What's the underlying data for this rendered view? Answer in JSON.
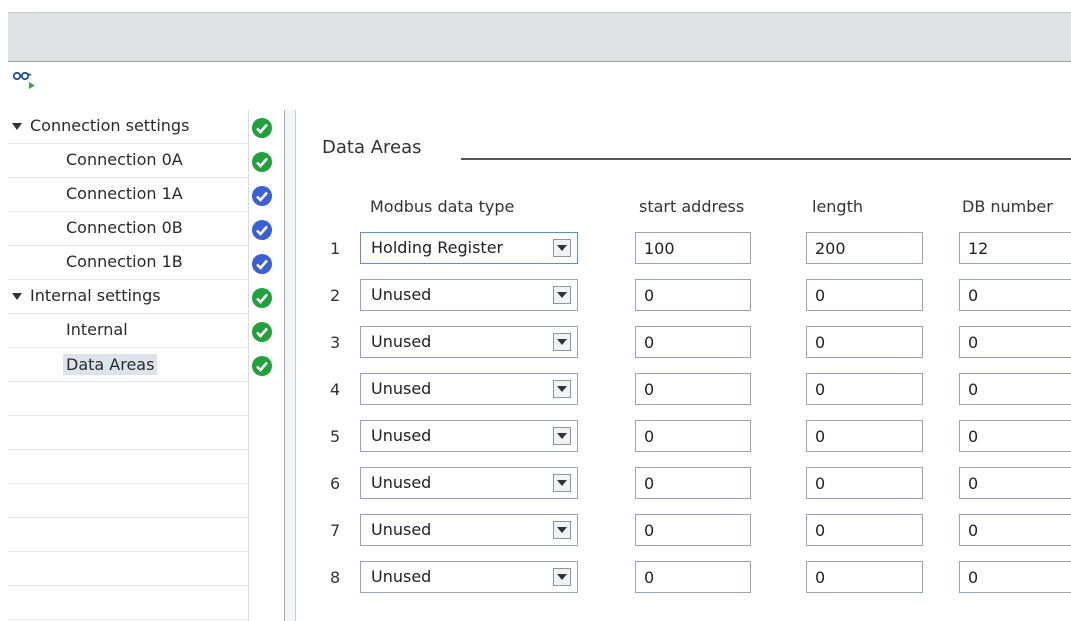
{
  "toolbar": {
    "icon": "glasses-run-icon"
  },
  "tree": {
    "groups": [
      {
        "label": "Connection settings",
        "status": "ok"
      },
      {
        "label": "Internal settings",
        "status": "ok"
      }
    ],
    "items": [
      {
        "label": "Connection 0A",
        "status": "ok"
      },
      {
        "label": "Connection 1A",
        "status": "pending"
      },
      {
        "label": "Connection 0B",
        "status": "pending"
      },
      {
        "label": "Connection 1B",
        "status": "pending"
      },
      {
        "label": "Internal",
        "status": "ok"
      },
      {
        "label": "Data Areas",
        "status": "ok",
        "selected": true
      }
    ]
  },
  "colors": {
    "ok": "#22a03c",
    "pending": "#3a5fd6",
    "selection": "#dde3ea"
  },
  "main": {
    "section_title": "Data Areas",
    "columns": {
      "type": "Modbus data type",
      "start": "start address",
      "length": "length",
      "db": "DB number"
    },
    "rows": [
      {
        "num": "1",
        "type": "Holding Register",
        "start": "100",
        "length": "200",
        "db": "12"
      },
      {
        "num": "2",
        "type": "Unused",
        "start": "0",
        "length": "0",
        "db": "0"
      },
      {
        "num": "3",
        "type": "Unused",
        "start": "0",
        "length": "0",
        "db": "0"
      },
      {
        "num": "4",
        "type": "Unused",
        "start": "0",
        "length": "0",
        "db": "0"
      },
      {
        "num": "5",
        "type": "Unused",
        "start": "0",
        "length": "0",
        "db": "0"
      },
      {
        "num": "6",
        "type": "Unused",
        "start": "0",
        "length": "0",
        "db": "0"
      },
      {
        "num": "7",
        "type": "Unused",
        "start": "0",
        "length": "0",
        "db": "0"
      },
      {
        "num": "8",
        "type": "Unused",
        "start": "0",
        "length": "0",
        "db": "0"
      }
    ]
  }
}
